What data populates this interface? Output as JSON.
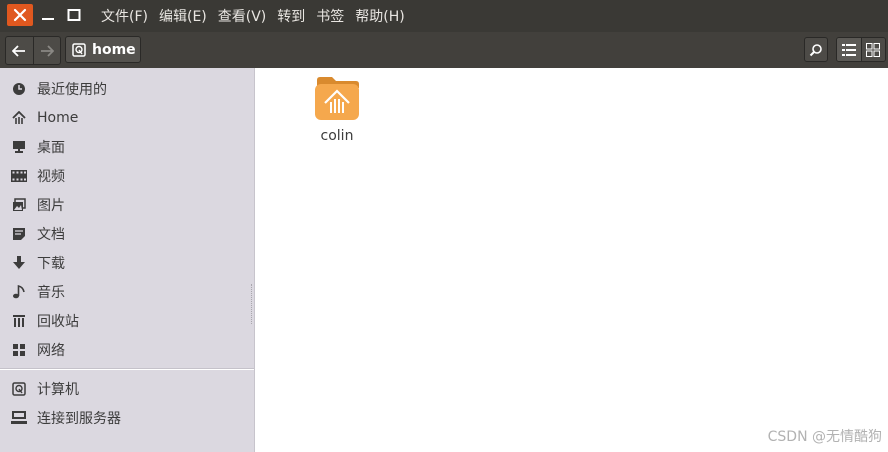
{
  "window": {
    "controls": {
      "close_icon": "close-icon",
      "minimize_icon": "minimize-icon",
      "maximize_icon": "maximize-icon"
    }
  },
  "menubar": {
    "items": [
      {
        "label": "文件(F)"
      },
      {
        "label": "编辑(E)"
      },
      {
        "label": "查看(V)"
      },
      {
        "label": "转到"
      },
      {
        "label": "书签"
      },
      {
        "label": "帮助(H)"
      }
    ]
  },
  "toolbar": {
    "back_icon": "arrow-left-icon",
    "forward_icon": "arrow-right-icon",
    "breadcrumb": {
      "icon": "drive-icon",
      "label": "home"
    },
    "search_icon": "search-icon",
    "view_list_icon": "list-view-icon",
    "view_grid_icon": "grid-view-icon"
  },
  "sidebar": {
    "places": [
      {
        "label": "最近使用的",
        "icon": "clock-icon"
      },
      {
        "label": "Home",
        "icon": "home-icon"
      },
      {
        "label": "桌面",
        "icon": "desktop-icon"
      },
      {
        "label": "视频",
        "icon": "film-icon"
      },
      {
        "label": "图片",
        "icon": "picture-icon"
      },
      {
        "label": "文档",
        "icon": "document-icon"
      },
      {
        "label": "下载",
        "icon": "download-arrow-icon"
      },
      {
        "label": "音乐",
        "icon": "music-note-icon"
      },
      {
        "label": "回收站",
        "icon": "trash-icon"
      },
      {
        "label": "网络",
        "icon": "network-icon"
      }
    ],
    "devices": [
      {
        "label": "计算机",
        "icon": "drive-icon"
      },
      {
        "label": "连接到服务器",
        "icon": "server-icon"
      }
    ]
  },
  "content": {
    "files": [
      {
        "name": "colin",
        "icon": "home-folder-icon"
      }
    ]
  },
  "watermark": "CSDN @无情酷狗",
  "colors": {
    "titlebar": "#3a3935",
    "toolbar": "#42403c",
    "close_button": "#e0581f",
    "sidebar": "#dbd8e0",
    "folder": "#f5a84d"
  }
}
